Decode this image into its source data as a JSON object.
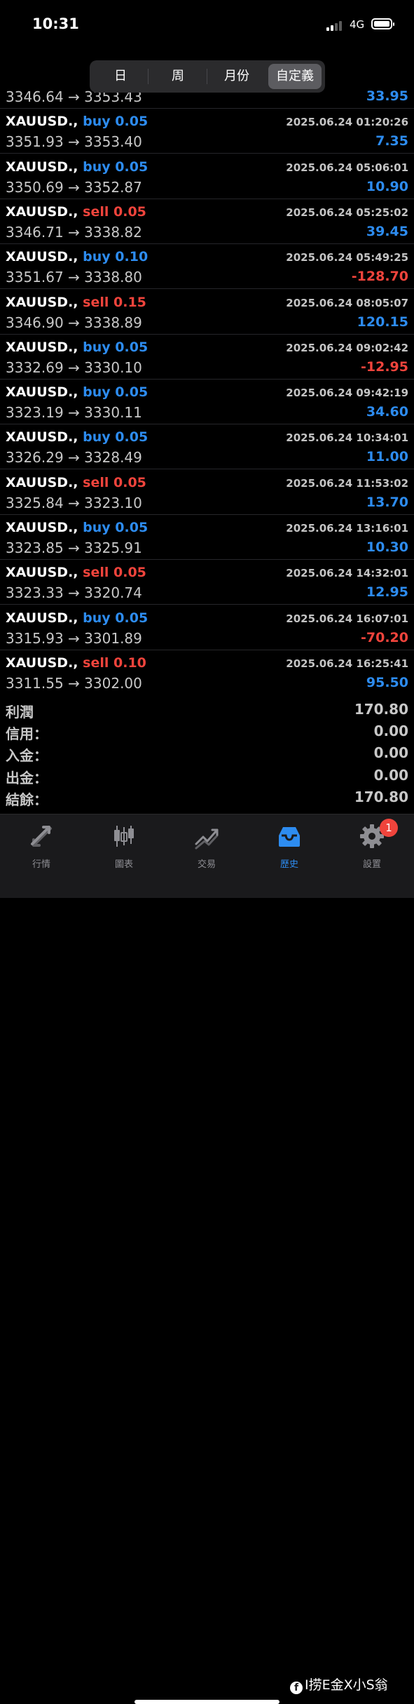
{
  "status_bar": {
    "time": "10:31",
    "network": "4G"
  },
  "segment": {
    "tabs": [
      {
        "label": "日",
        "active": false
      },
      {
        "label": "周",
        "active": false
      },
      {
        "label": "月份",
        "active": false
      },
      {
        "label": "自定義",
        "active": true
      }
    ]
  },
  "trades": [
    {
      "symbol": "",
      "side": "",
      "side_type": "",
      "volume": "",
      "prices": "3346.64 → 3353.43",
      "time": "",
      "profit": "33.95",
      "profit_sign": "pos"
    },
    {
      "symbol": "XAUUSD.,",
      "side": "buy",
      "side_type": "buy",
      "volume": "0.05",
      "prices": "3351.93 → 3353.40",
      "time": "2025.06.24 01:20:26",
      "profit": "7.35",
      "profit_sign": "pos"
    },
    {
      "symbol": "XAUUSD.,",
      "side": "buy",
      "side_type": "buy",
      "volume": "0.05",
      "prices": "3350.69 → 3352.87",
      "time": "2025.06.24 05:06:01",
      "profit": "10.90",
      "profit_sign": "pos"
    },
    {
      "symbol": "XAUUSD.,",
      "side": "sell",
      "side_type": "sell",
      "volume": "0.05",
      "prices": "3346.71 → 3338.82",
      "time": "2025.06.24 05:25:02",
      "profit": "39.45",
      "profit_sign": "pos"
    },
    {
      "symbol": "XAUUSD.,",
      "side": "buy",
      "side_type": "buy",
      "volume": "0.10",
      "prices": "3351.67 → 3338.80",
      "time": "2025.06.24 05:49:25",
      "profit": "-128.70",
      "profit_sign": "neg"
    },
    {
      "symbol": "XAUUSD.,",
      "side": "sell",
      "side_type": "sell",
      "volume": "0.15",
      "prices": "3346.90 → 3338.89",
      "time": "2025.06.24 08:05:07",
      "profit": "120.15",
      "profit_sign": "pos"
    },
    {
      "symbol": "XAUUSD.,",
      "side": "buy",
      "side_type": "buy",
      "volume": "0.05",
      "prices": "3332.69 → 3330.10",
      "time": "2025.06.24 09:02:42",
      "profit": "-12.95",
      "profit_sign": "neg"
    },
    {
      "symbol": "XAUUSD.,",
      "side": "buy",
      "side_type": "buy",
      "volume": "0.05",
      "prices": "3323.19 → 3330.11",
      "time": "2025.06.24 09:42:19",
      "profit": "34.60",
      "profit_sign": "pos"
    },
    {
      "symbol": "XAUUSD.,",
      "side": "buy",
      "side_type": "buy",
      "volume": "0.05",
      "prices": "3326.29 → 3328.49",
      "time": "2025.06.24 10:34:01",
      "profit": "11.00",
      "profit_sign": "pos"
    },
    {
      "symbol": "XAUUSD.,",
      "side": "sell",
      "side_type": "sell",
      "volume": "0.05",
      "prices": "3325.84 → 3323.10",
      "time": "2025.06.24 11:53:02",
      "profit": "13.70",
      "profit_sign": "pos"
    },
    {
      "symbol": "XAUUSD.,",
      "side": "buy",
      "side_type": "buy",
      "volume": "0.05",
      "prices": "3323.85 → 3325.91",
      "time": "2025.06.24 13:16:01",
      "profit": "10.30",
      "profit_sign": "pos"
    },
    {
      "symbol": "XAUUSD.,",
      "side": "sell",
      "side_type": "sell",
      "volume": "0.05",
      "prices": "3323.33 → 3320.74",
      "time": "2025.06.24 14:32:01",
      "profit": "12.95",
      "profit_sign": "pos"
    },
    {
      "symbol": "XAUUSD.,",
      "side": "buy",
      "side_type": "buy",
      "volume": "0.05",
      "prices": "3315.93 → 3301.89",
      "time": "2025.06.24 16:07:01",
      "profit": "-70.20",
      "profit_sign": "neg"
    },
    {
      "symbol": "XAUUSD.,",
      "side": "sell",
      "side_type": "sell",
      "volume": "0.10",
      "prices": "3311.55 → 3302.00",
      "time": "2025.06.24 16:25:41",
      "profit": "95.50",
      "profit_sign": "pos"
    }
  ],
  "summary": [
    {
      "label": "利潤",
      "value": "170.80"
    },
    {
      "label": "信用：",
      "value": "0.00"
    },
    {
      "label": "入金：",
      "value": "0.00"
    },
    {
      "label": "出金：",
      "value": "0.00"
    },
    {
      "label": "結餘：",
      "value": "170.80"
    }
  ],
  "tabbar": {
    "tabs": [
      {
        "label": "行情",
        "icon": "quotes-icon",
        "active": false
      },
      {
        "label": "圖表",
        "icon": "chart-icon",
        "active": false
      },
      {
        "label": "交易",
        "icon": "trade-icon",
        "active": false
      },
      {
        "label": "歷史",
        "icon": "history-icon",
        "active": true
      },
      {
        "label": "設置",
        "icon": "settings-icon",
        "active": false,
        "badge": "1"
      }
    ]
  },
  "watermark": "I捞E金X小S翁",
  "colors": {
    "buy": "#2d8cf0",
    "sell": "#f0443c",
    "background": "#000000",
    "tabbar": "#1a1a1c"
  }
}
